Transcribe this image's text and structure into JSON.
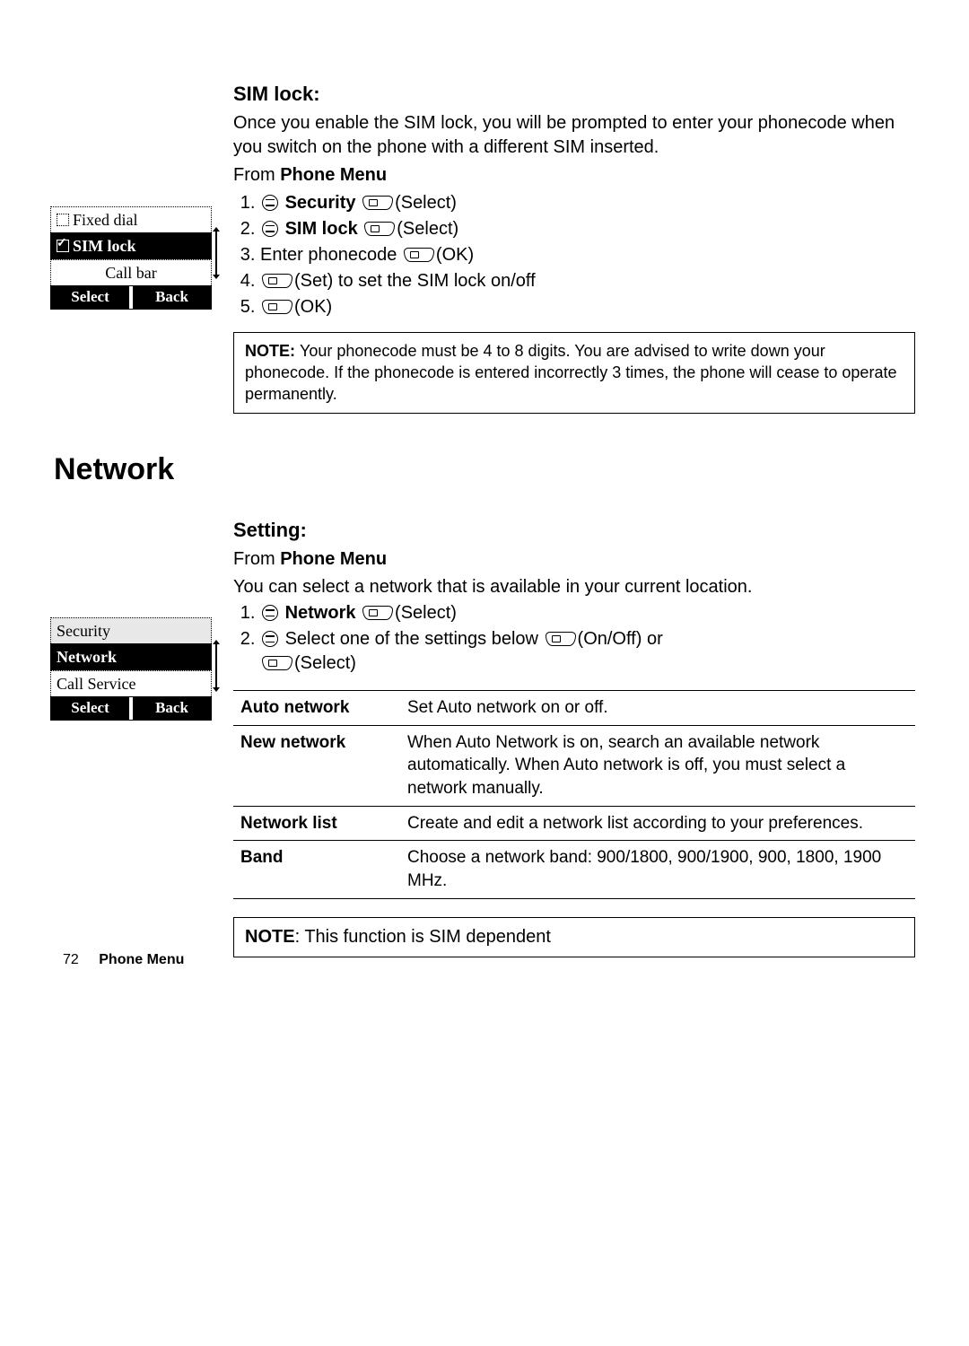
{
  "sim_lock": {
    "heading": "SIM lock:",
    "intro": "Once you enable the SIM lock, you will be prompted to enter your phonecode when you switch on the phone with a different SIM inserted.",
    "from_prefix": "From ",
    "from_menu": "Phone Menu",
    "steps": {
      "s1_label": "Security",
      "s1_action": "(Select)",
      "s2_label": "SIM lock",
      "s2_action": "(Select)",
      "s3_text": "Enter phonecode ",
      "s3_action": "(OK)",
      "s4_action": "(Set) to set the SIM lock on/off",
      "s5_action": "(OK)"
    },
    "note_label": "NOTE: ",
    "note_text": "Your phonecode must be 4 to 8 digits. You are advised to write down your phonecode. If the phonecode is entered incorrectly 3 times, the phone will cease to operate permanently."
  },
  "sim_thumb": {
    "r1": "Fixed dial",
    "r2": "SIM lock",
    "r3": "Call bar",
    "soft_left": "Select",
    "soft_right": "Back"
  },
  "network_section_title": "Network",
  "network": {
    "heading": "Setting:",
    "from_prefix": "From ",
    "from_menu": "Phone Menu",
    "desc": "You can select a network that is available in your current location.",
    "s1_label": "Network",
    "s1_action": "(Select)",
    "s2_text_a": "Select one of the settings below ",
    "s2_action_a": "(On/Off) or",
    "s2_action_b": "(Select)"
  },
  "net_thumb": {
    "r1": "Security",
    "r2": "Network",
    "r3": "Call Service",
    "soft_left": "Select",
    "soft_right": "Back"
  },
  "settings_table": [
    {
      "k": "Auto network",
      "v": "Set Auto network on or off."
    },
    {
      "k": "New network",
      "v": "When Auto Network is on, search an available network automatically. When Auto network is off, you must select a network manually."
    },
    {
      "k": "Network list",
      "v": "Create and edit a network list according to your preferences."
    },
    {
      "k": "Band",
      "v": "Choose a network band: 900/1800, 900/1900, 900, 1800, 1900 MHz."
    }
  ],
  "network_note_label": "NOTE",
  "network_note_text": ": This function is SIM dependent",
  "footer": {
    "page": "72",
    "title": "Phone Menu"
  }
}
